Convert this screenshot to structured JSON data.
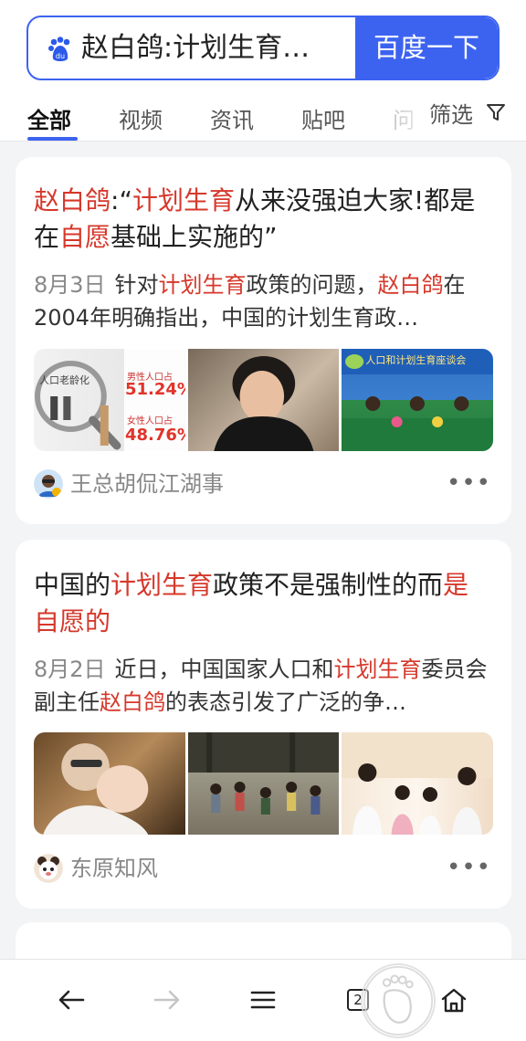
{
  "search": {
    "query": "赵白鸽:计划生育…",
    "button_label": "百度一下",
    "brand_color": "#3c63f0"
  },
  "tabs": [
    {
      "label": "全部",
      "active": true
    },
    {
      "label": "视频",
      "active": false
    },
    {
      "label": "资讯",
      "active": false
    },
    {
      "label": "贴吧",
      "active": false
    },
    {
      "label": "问",
      "active": false
    }
  ],
  "filter": {
    "label": "筛选",
    "icon": "funnel-icon"
  },
  "results": [
    {
      "title_parts": [
        {
          "text": "赵白鸽",
          "hl": true
        },
        {
          "text": ":“",
          "hl": false
        },
        {
          "text": "计划生育",
          "hl": true
        },
        {
          "text": "从来没强迫大家!都是在",
          "hl": false
        },
        {
          "text": "自愿",
          "hl": true
        },
        {
          "text": "基础上实施的”",
          "hl": false
        }
      ],
      "date": "8月3日",
      "summary_parts": [
        {
          "text": "针对",
          "hl": false
        },
        {
          "text": "计划生育",
          "hl": true
        },
        {
          "text": "政策的问题，",
          "hl": false
        },
        {
          "text": "赵白鸽",
          "hl": true
        },
        {
          "text": "在2004年明确指出，中国的计划生育政…",
          "hl": false
        }
      ],
      "images": [
        {
          "caption": "人口老龄化",
          "line1": "男性人口占",
          "stat1": "51.24%",
          "line2": "女性人口占",
          "stat2": "48.76%"
        },
        {
          "caption": ""
        },
        {
          "caption": "人口和计划生育座谈会"
        }
      ],
      "source": "王总胡侃江湖事",
      "more": "•••"
    },
    {
      "title_parts": [
        {
          "text": "中国的",
          "hl": false
        },
        {
          "text": "计划生育",
          "hl": true
        },
        {
          "text": "政策不是强制性的而",
          "hl": false
        },
        {
          "text": "是自愿的",
          "hl": true
        }
      ],
      "date": "8月2日",
      "summary_parts": [
        {
          "text": "近日，中国国家人口和",
          "hl": false
        },
        {
          "text": "计划生育",
          "hl": true
        },
        {
          "text": "委员会副主任",
          "hl": false
        },
        {
          "text": "赵白鸽",
          "hl": true
        },
        {
          "text": "的表态引发了广泛的争…",
          "hl": false
        }
      ],
      "images": [
        {
          "caption": ""
        },
        {
          "caption": ""
        },
        {
          "caption": ""
        }
      ],
      "source": "东原知风",
      "more": "•••"
    }
  ],
  "bottom_nav": {
    "back": "←",
    "forward": "→",
    "menu": "≡",
    "tab_count": "2",
    "home": "home-icon"
  },
  "colors": {
    "highlight": "#d6382b",
    "link_blue": "#3c63f0"
  }
}
